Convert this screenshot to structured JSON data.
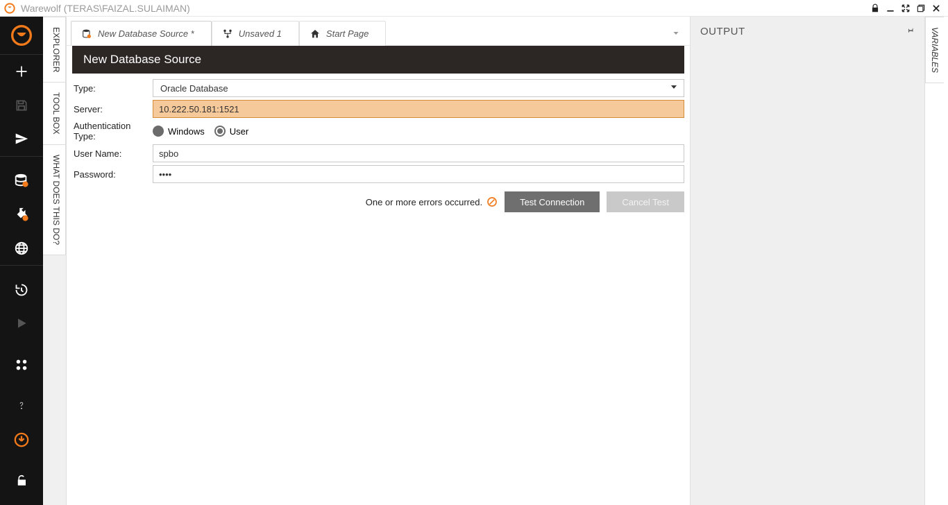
{
  "window": {
    "title": "Warewolf (TERAS\\FAIZAL.SULAIMAN)"
  },
  "left_tabs": {
    "explorer": "EXPLORER",
    "toolbox": "TOOL BOX",
    "help": "WHAT DOES THIS DO?"
  },
  "doc_tabs": [
    {
      "label": "New Database Source *"
    },
    {
      "label": "Unsaved 1"
    },
    {
      "label": "Start Page"
    }
  ],
  "form": {
    "header": "New Database Source",
    "labels": {
      "type": "Type:",
      "server": "Server:",
      "auth": "Authentication Type:",
      "user": "User Name:",
      "pass": "Password:"
    },
    "type_value": "Oracle Database",
    "server_value": "10.222.50.181:1521",
    "auth_options": {
      "windows": "Windows",
      "user": "User"
    },
    "auth_selected": "user",
    "user_value": "spbo",
    "pass_masked": "••••",
    "error_text": "One or more errors occurred.",
    "btn_test": "Test Connection",
    "btn_cancel": "Cancel Test"
  },
  "output": {
    "title": "OUTPUT"
  },
  "right_tab": {
    "variables": "VARIABLES"
  },
  "colors": {
    "accent": "#f27a1a"
  }
}
